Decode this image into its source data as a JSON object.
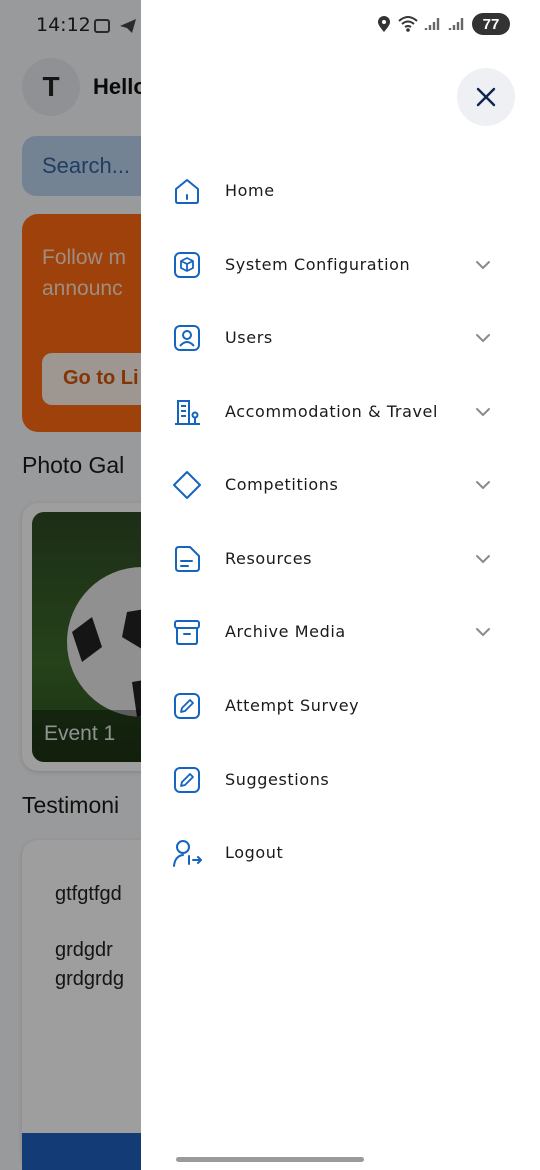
{
  "status_bar": {
    "time": "14:12",
    "battery": "77"
  },
  "background": {
    "avatar_letter": "T",
    "greeting": "Hello",
    "search_placeholder": "Search...",
    "banner_text_line1": "Follow m",
    "banner_text_line2": "announc",
    "banner_button": "Go to Li",
    "photo_gallery_heading": "Photo Gal",
    "photo_caption": "Event 1",
    "testimonials_heading": "Testimoni",
    "testimonial_line1": "gtfgtfgd",
    "testimonial_line2": "grdgdr",
    "testimonial_line3": "grdgrdg"
  },
  "drawer": {
    "menu": [
      {
        "label": "Home",
        "icon": "home-icon",
        "has_submenu": false
      },
      {
        "label": "System Configuration",
        "icon": "cube-icon",
        "has_submenu": true
      },
      {
        "label": "Users",
        "icon": "user-badge-icon",
        "has_submenu": true
      },
      {
        "label": "Accommodation & Travel",
        "icon": "building-icon",
        "has_submenu": true
      },
      {
        "label": "Competitions",
        "icon": "diamond-icon",
        "has_submenu": true
      },
      {
        "label": "Resources",
        "icon": "document-icon",
        "has_submenu": true
      },
      {
        "label": "Archive Media",
        "icon": "archive-icon",
        "has_submenu": true
      },
      {
        "label": "Attempt Survey",
        "icon": "edit-icon",
        "has_submenu": false
      },
      {
        "label": "Suggestions",
        "icon": "edit-icon",
        "has_submenu": false
      },
      {
        "label": "Logout",
        "icon": "logout-icon",
        "has_submenu": false
      }
    ],
    "accent_color": "#1565c0"
  }
}
